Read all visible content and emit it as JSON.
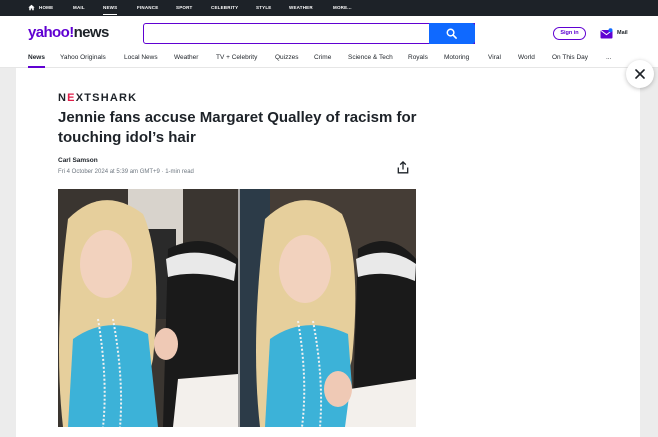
{
  "topbar": {
    "items": [
      "HOME",
      "MAIL",
      "NEWS",
      "FINANCE",
      "SPORT",
      "CELEBRITY",
      "STYLE",
      "WEATHER",
      "MORE..."
    ],
    "active_index": 2
  },
  "header": {
    "logo_main": "yahoo",
    "logo_bang": "!",
    "logo_section": "news",
    "search_placeholder": "",
    "signin_label": "Sign in",
    "mail_label": "Mail"
  },
  "nav": {
    "items": [
      "News",
      "Yahoo Originals",
      "Local News",
      "Weather",
      "TV + Celebrity",
      "Quizzes",
      "Crime",
      "Science & Tech",
      "Royals",
      "Motoring",
      "Viral",
      "World",
      "On This Day",
      "..."
    ],
    "active_index": 0
  },
  "article": {
    "source_prefix": "N",
    "source_accent": "E",
    "source_suffix": "XTSHARK",
    "headline": "Jennie fans accuse Margaret Qualley of racism for touching idol’s hair",
    "author": "Carl Samson",
    "meta": "Fri 4 October 2024 at 5:39 am GMT+9 · 1-min read",
    "image_alt": "Two side-by-side frames of a blonde woman in a blue top with pearl necklaces beside a person in a white cap"
  },
  "colors": {
    "brand_purple": "#6001d2",
    "search_blue": "#0f69ff",
    "topbar_bg": "#1d2228",
    "page_bg": "#ececec"
  }
}
